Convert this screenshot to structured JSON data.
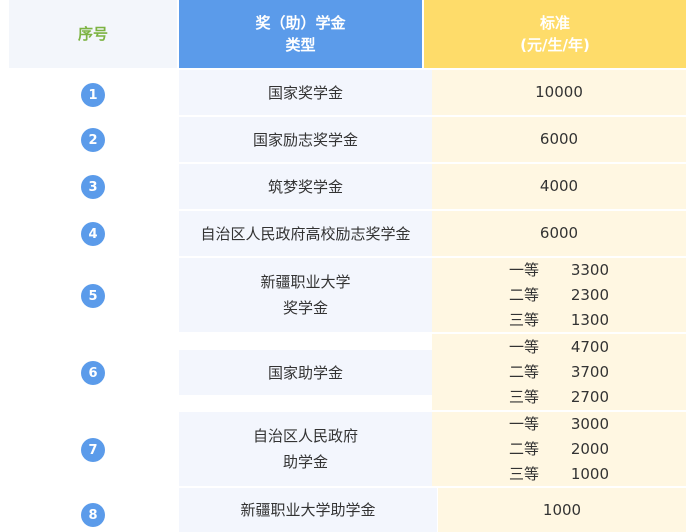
{
  "header": {
    "no": "序号",
    "type_line1": "奖（助）学金",
    "type_line2": "类型",
    "std_line1": "标准",
    "std_line2": "(元/生/年)"
  },
  "rows": [
    {
      "no": "1",
      "type": [
        "国家奖学金"
      ],
      "standard": "10000"
    },
    {
      "no": "2",
      "type": [
        "国家励志奖学金"
      ],
      "standard": "6000"
    },
    {
      "no": "3",
      "type": [
        "筑梦奖学金"
      ],
      "standard": "4000"
    },
    {
      "no": "4",
      "type": [
        "自治区人民政府高校励志奖学金"
      ],
      "standard": "6000"
    },
    {
      "no": "5",
      "type": [
        "新疆职业大学",
        "奖学金"
      ],
      "tiers": [
        {
          "grade": "一等",
          "amount": "3300"
        },
        {
          "grade": "二等",
          "amount": "2300"
        },
        {
          "grade": "三等",
          "amount": "1300"
        }
      ]
    },
    {
      "no": "6",
      "type": [
        "国家助学金"
      ],
      "tiers": [
        {
          "grade": "一等",
          "amount": "4700"
        },
        {
          "grade": "二等",
          "amount": "3700"
        },
        {
          "grade": "三等",
          "amount": "2700"
        }
      ]
    },
    {
      "no": "7",
      "type": [
        "自治区人民政府",
        "助学金"
      ],
      "tiers": [
        {
          "grade": "一等",
          "amount": "3000"
        },
        {
          "grade": "二等",
          "amount": "2000"
        },
        {
          "grade": "三等",
          "amount": "1000"
        }
      ]
    },
    {
      "no": "8",
      "type": [
        "新疆职业大学助学金"
      ],
      "standard": "1000"
    }
  ],
  "colors": {
    "header_blue": "#5b9bea",
    "header_yellow": "#fedc6a",
    "number_green": "#7cb342"
  }
}
